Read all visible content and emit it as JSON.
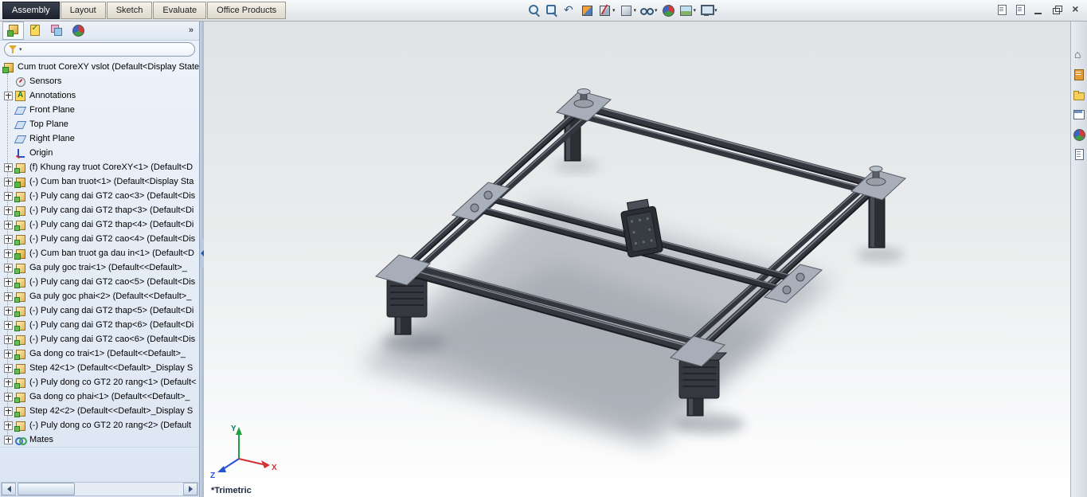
{
  "ribbon": {
    "tabs": [
      {
        "label": "Assembly",
        "name": "tab-assembly",
        "active": true
      },
      {
        "label": "Layout",
        "name": "tab-layout"
      },
      {
        "label": "Sketch",
        "name": "tab-sketch"
      },
      {
        "label": "Evaluate",
        "name": "tab-evaluate"
      },
      {
        "label": "Office Products",
        "name": "tab-office-products"
      }
    ]
  },
  "headsup": {
    "buttons": [
      {
        "name": "zoom-fit-button",
        "icon": "zoom-fit"
      },
      {
        "name": "zoom-area-button",
        "icon": "zoom-area"
      },
      {
        "name": "previous-view-button",
        "icon": "prev-view"
      },
      {
        "name": "view-orientation-button",
        "icon": "view-cube"
      },
      {
        "name": "section-view-button",
        "icon": "section",
        "dropdown": true
      },
      {
        "name": "display-style-button",
        "icon": "display-style",
        "dropdown": true
      },
      {
        "name": "hide-show-items-button",
        "icon": "hide-show",
        "dropdown": true
      },
      {
        "name": "edit-appearance-button",
        "icon": "appearance"
      },
      {
        "name": "apply-scene-button",
        "icon": "scene",
        "dropdown": true
      },
      {
        "name": "view-settings-button",
        "icon": "monitor",
        "dropdown": true
      }
    ]
  },
  "window": {
    "buttons": [
      {
        "name": "collapse-document-button",
        "icon": "docA"
      },
      {
        "name": "new-window-button",
        "icon": "docA"
      },
      {
        "name": "minimize-button",
        "icon": "min"
      },
      {
        "name": "restore-button",
        "icon": "restore"
      },
      {
        "name": "close-button",
        "icon": "close"
      }
    ]
  },
  "panel": {
    "more_label": "»",
    "tabs": [
      {
        "name": "featuremanager-tab",
        "icon": "fmtree",
        "active": true
      },
      {
        "name": "propertymanager-tab",
        "icon": "pm"
      },
      {
        "name": "configurationmanager-tab",
        "icon": "cfg"
      },
      {
        "name": "displaymanager-tab",
        "icon": "dm"
      }
    ]
  },
  "tree": {
    "items": [
      {
        "label": "Cum truot CoreXY vslot  (Default<Display State",
        "icon": "assembly",
        "root": true,
        "expander": false
      },
      {
        "label": "Sensors",
        "icon": "sensors",
        "expander": false
      },
      {
        "label": "Annotations",
        "icon": "annotations",
        "expander": true
      },
      {
        "label": "Front Plane",
        "icon": "plane",
        "expander": false
      },
      {
        "label": "Top Plane",
        "icon": "plane",
        "expander": false
      },
      {
        "label": "Right Plane",
        "icon": "plane",
        "expander": false
      },
      {
        "label": "Origin",
        "icon": "origin",
        "expander": false
      },
      {
        "label": "(f) Khung ray truot CoreXY<1> (Default<D",
        "icon": "part",
        "expander": true
      },
      {
        "label": "(-) Cum ban truot<1> (Default<Display Sta",
        "icon": "assembly",
        "expander": true
      },
      {
        "label": "(-) Puly cang dai GT2 cao<3> (Default<Dis",
        "icon": "part",
        "expander": true
      },
      {
        "label": "(-) Puly cang dai GT2 thap<3> (Default<Di",
        "icon": "part",
        "expander": true
      },
      {
        "label": "(-) Puly cang dai GT2 thap<4> (Default<Di",
        "icon": "part",
        "expander": true
      },
      {
        "label": "(-) Puly cang dai GT2 cao<4> (Default<Dis",
        "icon": "part",
        "expander": true
      },
      {
        "label": "(-) Cum ban truot ga dau in<1> (Default<D",
        "icon": "assembly",
        "expander": true
      },
      {
        "label": "Ga puly goc trai<1> (Default<<Default>_",
        "icon": "part",
        "expander": true
      },
      {
        "label": "(-) Puly cang dai GT2 cao<5> (Default<Dis",
        "icon": "part",
        "expander": true
      },
      {
        "label": "Ga puly goc phai<2> (Default<<Default>_",
        "icon": "part",
        "expander": true
      },
      {
        "label": "(-) Puly cang dai GT2 thap<5> (Default<Di",
        "icon": "part",
        "expander": true
      },
      {
        "label": "(-) Puly cang dai GT2 thap<6> (Default<Di",
        "icon": "part",
        "expander": true
      },
      {
        "label": "(-) Puly cang dai GT2 cao<6> (Default<Dis",
        "icon": "part",
        "expander": true
      },
      {
        "label": "Ga dong co trai<1> (Default<<Default>_",
        "icon": "part",
        "expander": true
      },
      {
        "label": "Step 42<1> (Default<<Default>_Display S",
        "icon": "part",
        "expander": true
      },
      {
        "label": "(-) Puly dong co GT2 20 rang<1> (Default<",
        "icon": "part",
        "expander": true
      },
      {
        "label": "Ga dong co phai<1> (Default<<Default>_",
        "icon": "part",
        "expander": true
      },
      {
        "label": "Step 42<2> (Default<<Default>_Display S",
        "icon": "part",
        "expander": true
      },
      {
        "label": "(-) Puly dong co GT2 20 rang<2> (Default",
        "icon": "part",
        "expander": true
      },
      {
        "label": "Mates",
        "icon": "mates",
        "expander": true
      }
    ]
  },
  "taskpane": {
    "buttons": [
      {
        "name": "resources-button",
        "icon": "home"
      },
      {
        "name": "design-library-button",
        "icon": "library"
      },
      {
        "name": "file-explorer-button",
        "icon": "folder"
      },
      {
        "name": "view-palette-button",
        "icon": "palette"
      },
      {
        "name": "appearances-button",
        "icon": "ball"
      },
      {
        "name": "custom-properties-button",
        "icon": "props"
      }
    ]
  },
  "viewport": {
    "view_label": "*Trimetric"
  },
  "icon_glyphs": {
    "zoom-fit": "magnifier",
    "zoom-area": "magnifier-square",
    "prev-view": "undo-arrow",
    "view-cube": "orange-blue-cube",
    "section": "cut-cube",
    "display-style": "shaded-cube",
    "hide-show": "eyeglasses",
    "appearance": "rgb-sphere",
    "scene": "landscape",
    "monitor": "screen",
    "home": "house",
    "library": "book",
    "folder": "folder",
    "palette": "window",
    "ball": "rgb-sphere",
    "props": "document"
  }
}
